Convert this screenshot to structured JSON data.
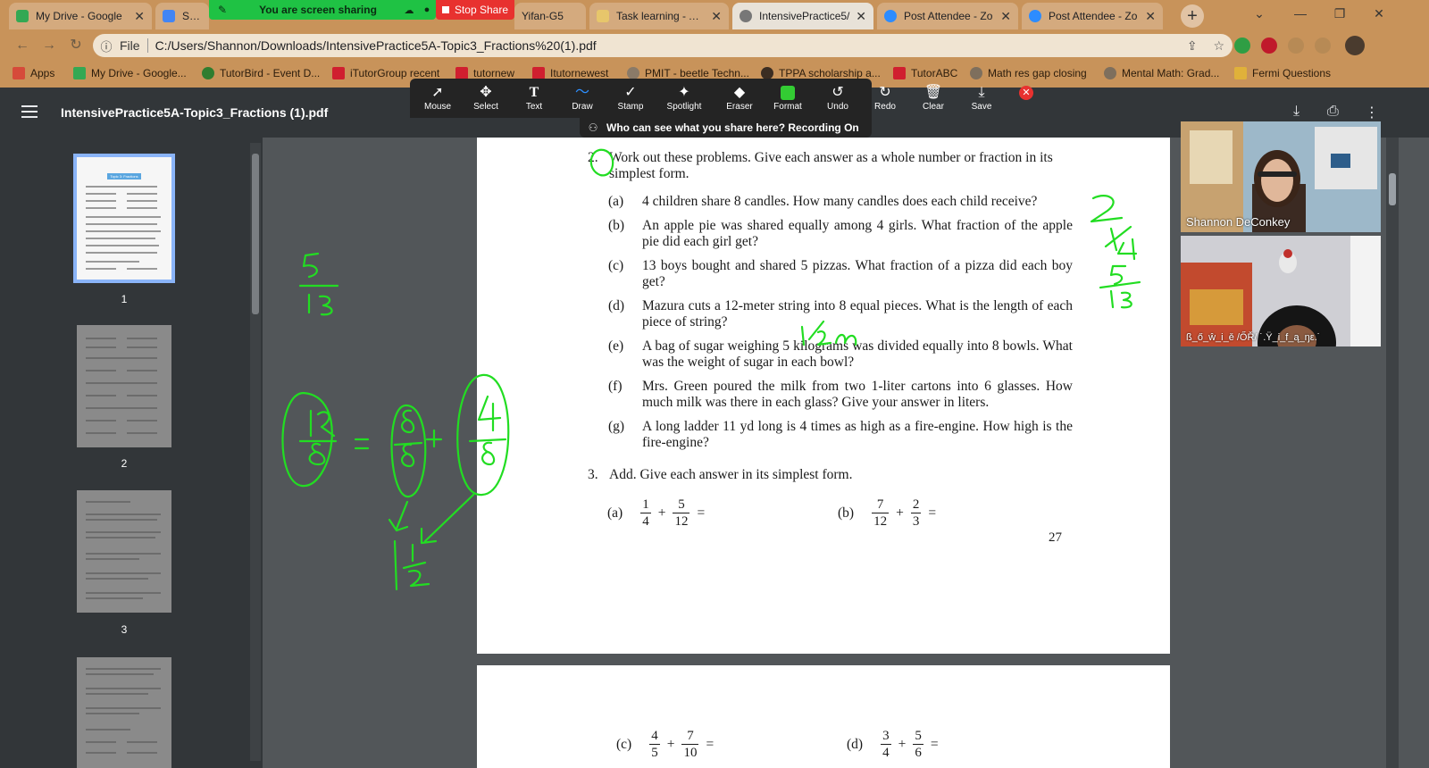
{
  "browser": {
    "tabs": [
      {
        "title": "My Drive - Google",
        "color": "#34a853"
      },
      {
        "title": "Sept",
        "color": "#4285f4"
      },
      {
        "title": "Yifan-G5",
        "color": "#f2a33a"
      },
      {
        "title": "Task learning - Aca",
        "color": "#e7c66b"
      },
      {
        "title": "IntensivePractice5/",
        "color": "#777777"
      },
      {
        "title": "Post Attendee - Zo",
        "color": "#2d8cff"
      },
      {
        "title": "Post Attendee - Zo",
        "color": "#2d8cff"
      }
    ],
    "address_scheme": "File",
    "url": "C:/Users/Shannon/Downloads/IntensivePractice5A-Topic3_Fractions%20(1).pdf",
    "bookmarks": [
      "Apps",
      "My Drive - Google...",
      "TutorBird - Event D...",
      "iTutorGroup recent",
      "tutornew",
      "Itutornewest",
      "PMIT - beetle Techn...",
      "TPPA scholarship a...",
      "TutorABC",
      "Math res gap closing",
      "Mental Math: Grad...",
      "Fermi Questions"
    ]
  },
  "zoom": {
    "sharing_label": "You are screen sharing",
    "stop_share_label": "Stop Share",
    "tools": [
      "Mouse",
      "Select",
      "Text",
      "Draw",
      "Stamp",
      "Spotlight",
      "Eraser",
      "Format",
      "Undo",
      "Redo",
      "Clear",
      "Save"
    ],
    "recording_notice": "Who can see what you share here? Recording On",
    "participants": [
      {
        "name": "Shannon DeConkey"
      },
      {
        "name": "ß_ő_ŵ_i_ě /ŐŘ/ ˙.Ÿ_i_f_ą_ŋε.˙"
      }
    ],
    "ink_color": "#22dd22"
  },
  "pdf": {
    "title": "IntensivePractice5A-Topic3_Fractions (1).pdf",
    "thumbnails": [
      {
        "num": "1"
      },
      {
        "num": "2"
      },
      {
        "num": "3"
      }
    ],
    "thumb_title": "Topic 3: Fractions",
    "q2": {
      "num": "2.",
      "prompt": "Work out these problems.  Give each answer as a whole number or fraction in its simplest form.",
      "parts": [
        {
          "label": "(a)",
          "text": "4 children share 8 candles. How many candles does each child receive?"
        },
        {
          "label": "(b)",
          "text": "An apple pie was shared equally among 4 girls. What fraction of the apple pie did each girl get?"
        },
        {
          "label": "(c)",
          "text": "13 boys bought and shared 5 pizzas. What fraction of a pizza did each boy get?"
        },
        {
          "label": "(d)",
          "text": "Mazura cuts a 12-meter string into 8 equal pieces. What is the length of each piece of string?"
        },
        {
          "label": "(e)",
          "text": "A bag of sugar weighing 5 kilograms was divided equally into 8 bowls. What was the weight of sugar in each bowl?"
        },
        {
          "label": "(f)",
          "text": "Mrs. Green poured the milk from two 1-liter cartons into 6 glasses. How much milk was there in each glass? Give your answer in liters."
        },
        {
          "label": "(g)",
          "text": "A long ladder 11 yd long is 4 times as high as a fire-engine. How high is the fire-engine?"
        }
      ]
    },
    "q3": {
      "num": "3.",
      "prompt": "Add. Give each answer in its simplest form.",
      "items": [
        {
          "label": "(a)",
          "a_n": "1",
          "a_d": "4",
          "b_n": "5",
          "b_d": "12"
        },
        {
          "label": "(b)",
          "a_n": "7",
          "a_d": "12",
          "b_n": "2",
          "b_d": "3"
        },
        {
          "label": "(c)",
          "a_n": "4",
          "a_d": "5",
          "b_n": "7",
          "b_d": "10"
        },
        {
          "label": "(d)",
          "a_n": "3",
          "a_d": "4",
          "b_n": "5",
          "b_d": "6"
        }
      ]
    },
    "page_number": "27"
  }
}
